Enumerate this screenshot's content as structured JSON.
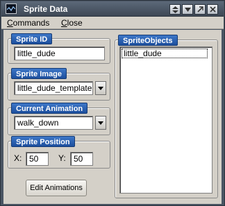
{
  "window": {
    "title": "Sprite Data",
    "controls": [
      "restore-up",
      "restore-down",
      "minimize",
      "close"
    ]
  },
  "menu": [
    {
      "label": "Commands",
      "accel": "C",
      "rest": "ommands"
    },
    {
      "label": "Close",
      "accel": "C",
      "rest": "lose"
    }
  ],
  "sprite_id": {
    "title": "Sprite ID",
    "value": "little_dude"
  },
  "sprite_image": {
    "title": "Sprite Image",
    "value": "little_dude_template"
  },
  "current_animation": {
    "title": "Current Animation",
    "value": "walk_down"
  },
  "sprite_position": {
    "title": "Sprite Position",
    "x_label": "X:",
    "x_value": "50",
    "y_label": "Y:",
    "y_value": "50"
  },
  "edit_button": {
    "label": "Edit Animations"
  },
  "sprite_objects": {
    "title": "SpriteObjects",
    "items": [
      "little_dude"
    ]
  }
}
